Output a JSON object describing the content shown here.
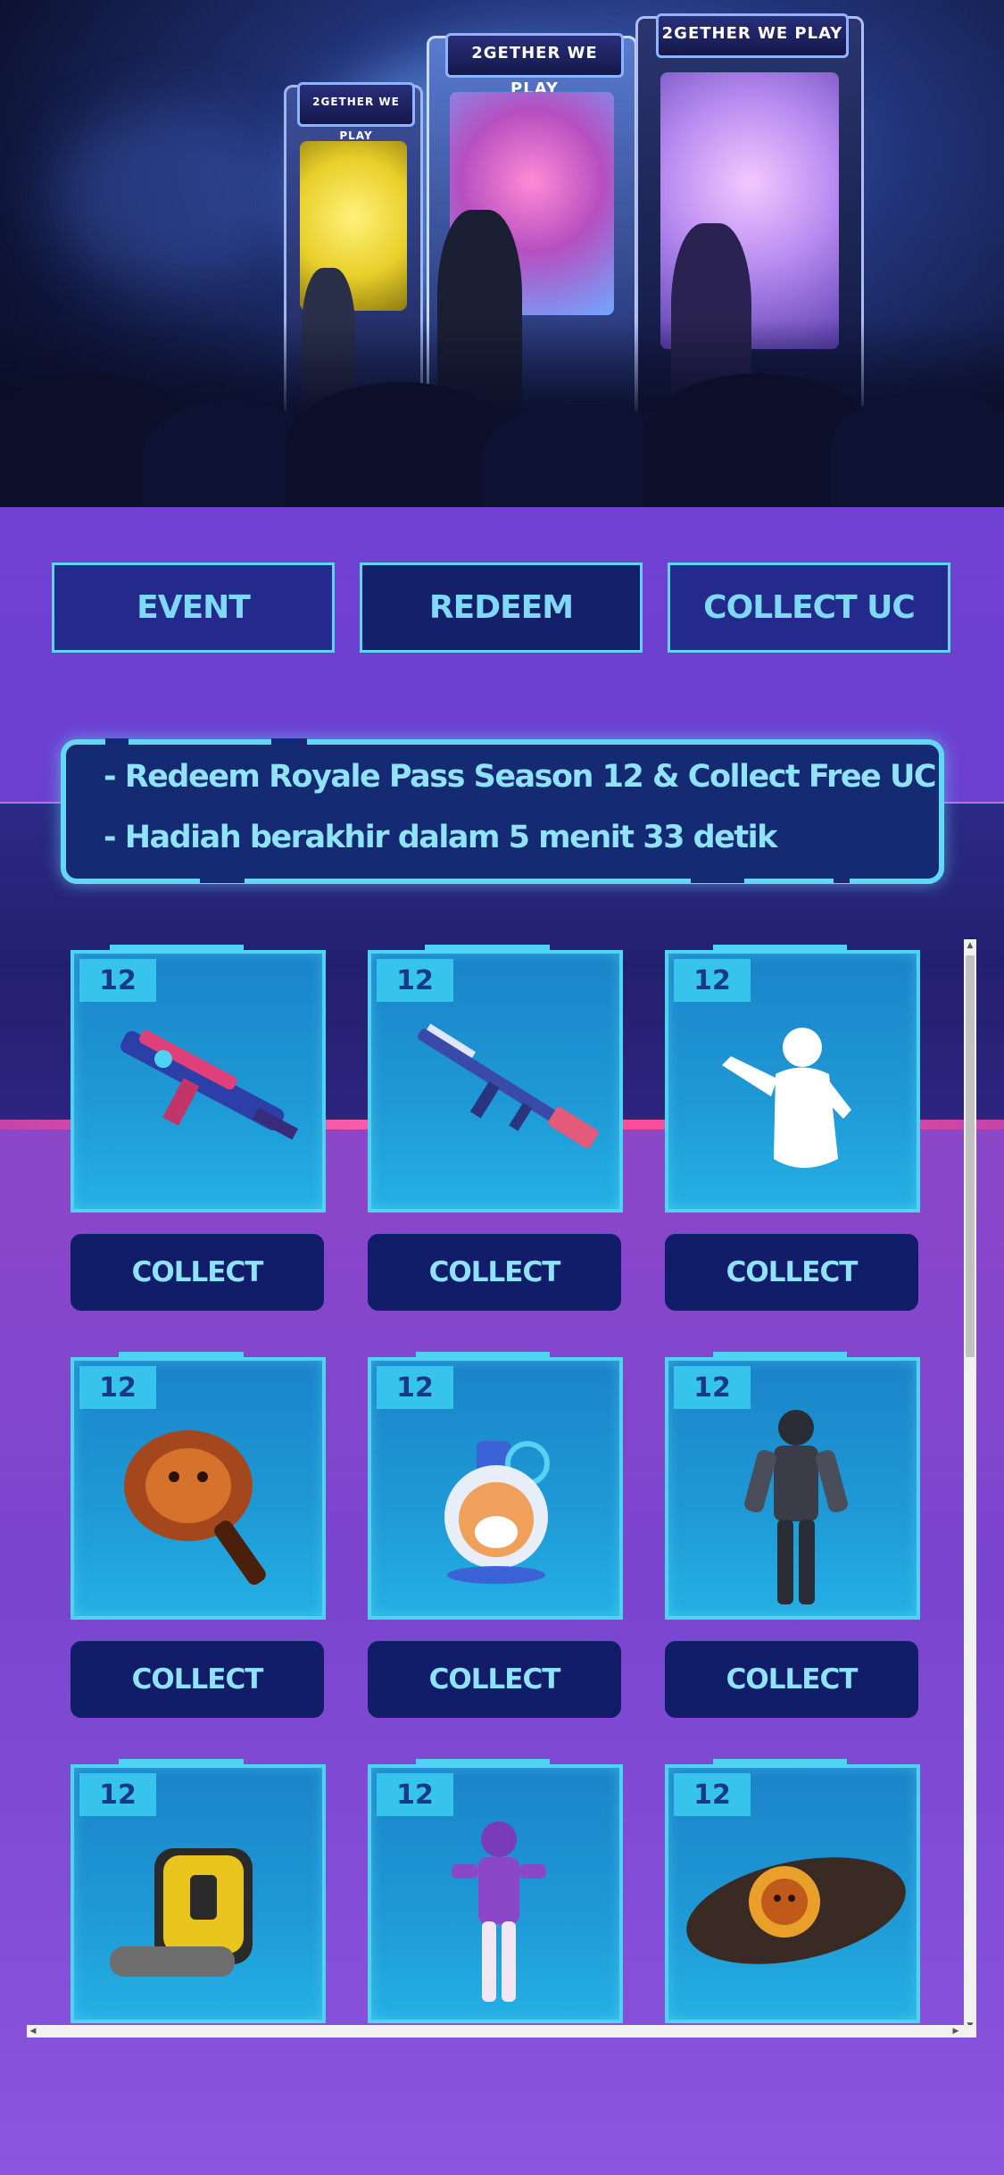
{
  "hero": {
    "marquee_text": "2GETHER WE PLAY"
  },
  "tabs": [
    {
      "label": "EVENT"
    },
    {
      "label": "REDEEM"
    },
    {
      "label": "COLLECT UC"
    }
  ],
  "info": {
    "lines": [
      "- Redeem Royale Pass Season 12 & Collect Free UC",
      "- Hadiah berakhir dalam 5 menit 33 detik"
    ]
  },
  "items": [
    {
      "badge": "12",
      "icon": "rifle-skin-icon",
      "button": "COLLECT"
    },
    {
      "badge": "12",
      "icon": "m416-rifle-icon",
      "button": "COLLECT"
    },
    {
      "badge": "12",
      "icon": "emote-silhouette-icon",
      "button": "COLLECT"
    },
    {
      "badge": "12",
      "icon": "lion-pan-icon",
      "button": "COLLECT"
    },
    {
      "badge": "12",
      "icon": "shiba-grenade-icon",
      "button": "COLLECT"
    },
    {
      "badge": "12",
      "icon": "armored-outfit-icon",
      "button": "COLLECT"
    },
    {
      "badge": "12",
      "icon": "yellow-backpack-icon",
      "button": "COLLECT"
    },
    {
      "badge": "12",
      "icon": "purple-outfit-icon",
      "button": "COLLECT"
    },
    {
      "badge": "12",
      "icon": "lion-parachute-icon",
      "button": "COLLECT"
    }
  ],
  "colors": {
    "accent": "#5fd4f5",
    "button_bg": "#121d6a",
    "card_bg": "#1f9ad6"
  }
}
